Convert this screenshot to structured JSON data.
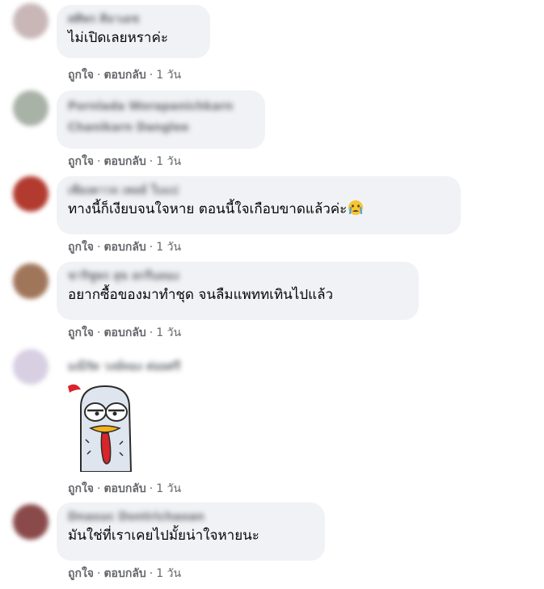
{
  "comments": [
    {
      "name": "ศศิพร ศิลาเดช",
      "text": "ไม่เปิดเลยหราค่ะ",
      "like": "ถูกใจ",
      "reply": "ตอบกลับ",
      "time": "1 วัน",
      "avatar_color": "#c9b7b8"
    },
    {
      "name": "Pornlada Worapanichkarn",
      "name2": "Chanikarn Danglee",
      "like": "ถูกใจ",
      "reply": "ตอบกลับ",
      "time": "1 วัน",
      "avatar_color": "#a9b2a7"
    },
    {
      "name": "เพียงดาวจ เพลย์ ใบแป",
      "text": "ทางนี้ก็เงียบจนใจหาย ตอนนี้ใจเกือบขาดแล้วค่ะ",
      "emoji": "crying-face",
      "like": "ถูกใจ",
      "reply": "ตอบกลับ",
      "time": "1 วัน",
      "avatar_color": "#b23a2f"
    },
    {
      "name": "ชาริชูพร สุข สกรีนทอง",
      "text": "อยากซื้อของมาทำชุด จนลืมแพททเทินไปแล้ว",
      "like": "ถูกใจ",
      "reply": "ตอบกลับ",
      "time": "1 วัน",
      "avatar_color": "#a0765a"
    },
    {
      "name": "มณีรัต วงษ์ทอง ต่อยศรี",
      "sticker": "chicken-sticker",
      "like": "ถูกใจ",
      "reply": "ตอบกลับ",
      "time": "1 วัน",
      "avatar_color": "#d8cfe3"
    },
    {
      "name": "Dnasuc Dontrichaoan",
      "text": "มันใช่ที่เราเคยไปมั้ยน่าใจหายนะ",
      "like": "ถูกใจ",
      "reply": "ตอบกลับ",
      "time": "1 วัน",
      "avatar_color": "#8a4a4a"
    }
  ],
  "separator": "·"
}
